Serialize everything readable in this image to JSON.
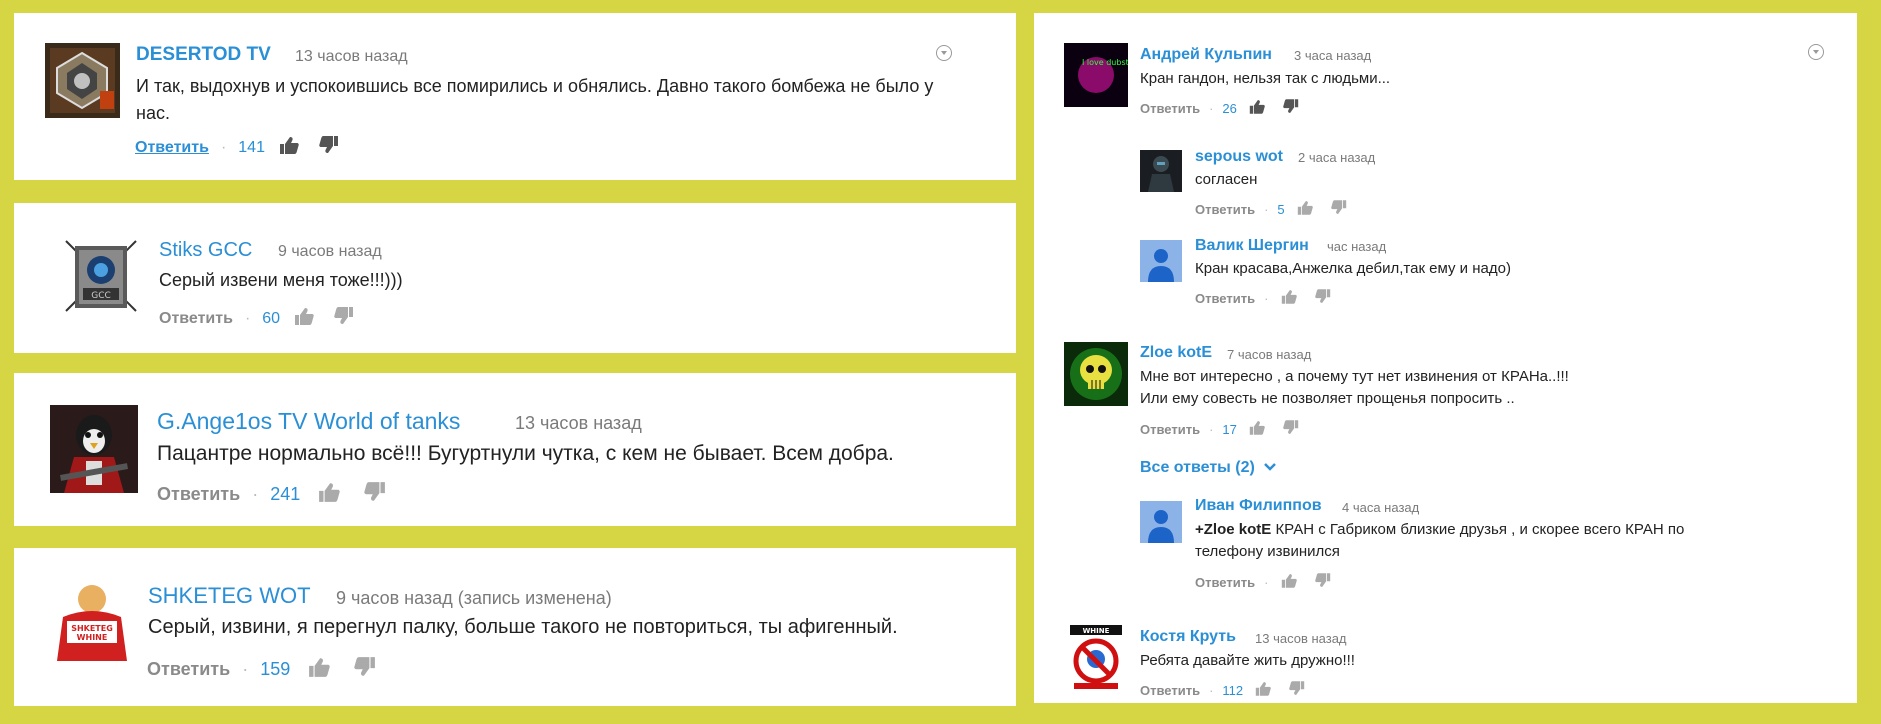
{
  "left": [
    {
      "name": "DESERTOD TV",
      "time": "13 часов назад",
      "text": "И так, выдохнув и успокоившись все помирились и обнялись. Давно такого бомбежа не было у нас.",
      "reply": "Ответить",
      "likes": "141"
    },
    {
      "name": "Stiks GCC",
      "time": "9 часов назад",
      "text": "Серый извени меня тоже!!!)))",
      "reply": "Ответить",
      "likes": "60"
    },
    {
      "name": "G.Ange1os TV World of tanks",
      "time": "13 часов назад",
      "text": "Пацантре нормально всё!!! Бугуртнули чутка, с кем не бывает. Всем добра.",
      "reply": "Ответить",
      "likes": "241"
    },
    {
      "name": "SHKETEG WOT",
      "time": "9 часов назад (запись изменена)",
      "text": "Серый, извини, я перегнул палку, больше такого не повториться, ты афигенный.",
      "reply": "Ответить",
      "likes": "159"
    }
  ],
  "right": {
    "comments": [
      {
        "name": "Андрей Кульпин",
        "time": "3 часа назад",
        "text": "Кран гандон, нельзя так с людьми...",
        "reply": "Ответить",
        "likes": "26",
        "avatar_text": "I love dubstep"
      },
      {
        "name": "sepous wot",
        "time": "2 часа назад",
        "text": "согласен",
        "reply": "Ответить",
        "likes": "5"
      },
      {
        "name": "Валик Шергин",
        "time": "час назад",
        "text": "Кран красава,Анжелка дебил,так ему и надо)",
        "reply": "Ответить",
        "likes": ""
      },
      {
        "name": "Zloe kotE",
        "time": "7 часов назад",
        "text_line1": "Мне вот интересно , а почему тут нет извинения от КРАНа..!!!",
        "text_line2": "Или ему совесть не позволяет прощенья попросить ..",
        "reply": "Ответить",
        "likes": "17"
      },
      {
        "name": "Иван Филиппов",
        "time": "4 часа назад",
        "mention": "+Zloe kotE",
        "text_line1": " КРАН с Габриком близкие друзья , и скорее всего КРАН по",
        "text_line2": "телефону извинился",
        "reply": "Ответить",
        "likes": ""
      },
      {
        "name": "Костя Круть",
        "time": "13 часов назад",
        "text": "Ребята давайте жить дружно!!!",
        "reply": "Ответить",
        "likes": "112",
        "avatar_text": "WHINE"
      }
    ],
    "view_all": "Все ответы (2)"
  },
  "colors": {
    "background": "#d6d544",
    "link": "#2b8fd6"
  }
}
